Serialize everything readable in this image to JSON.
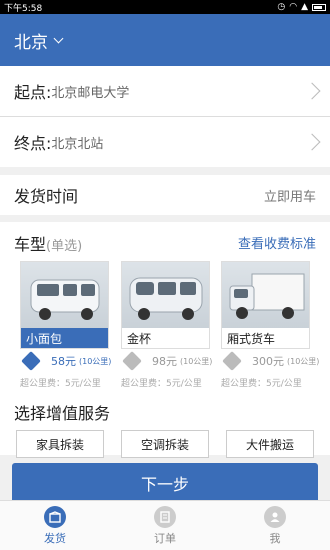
{
  "status": {
    "time": "下午5:58"
  },
  "header": {
    "city": "北京"
  },
  "route": {
    "start_label": "起点:",
    "start_value": "北京邮电大学",
    "end_label": "终点:",
    "end_value": "北京北站"
  },
  "time": {
    "label": "发货时间",
    "value": "立即用车"
  },
  "vehicle": {
    "title": "车型",
    "subtitle": "(单选)",
    "fee_link": "查看收费标准",
    "cars": [
      {
        "name": "小面包",
        "price": "58元",
        "unit": "(10公里)",
        "over": "超公里费：5元/公里",
        "selected": true
      },
      {
        "name": "金杯",
        "price": "98元",
        "unit": "(10公里)",
        "over": "超公里费：5元/公里",
        "selected": false
      },
      {
        "name": "厢式货车",
        "price": "300元",
        "unit": "(10公里)",
        "over": "超公里费：5元/公里",
        "selected": false
      }
    ]
  },
  "services": {
    "title": "选择增值服务",
    "items": [
      "家具拆装",
      "空调拆装",
      "大件搬运"
    ]
  },
  "actions": {
    "next": "下一步"
  },
  "tabs": [
    {
      "label": "发货",
      "icon": "package-icon",
      "active": true
    },
    {
      "label": "订单",
      "icon": "order-icon",
      "active": false
    },
    {
      "label": "我",
      "icon": "user-icon",
      "active": false
    }
  ],
  "colors": {
    "primary": "#3a6db8",
    "background": "#f0f0f0"
  }
}
